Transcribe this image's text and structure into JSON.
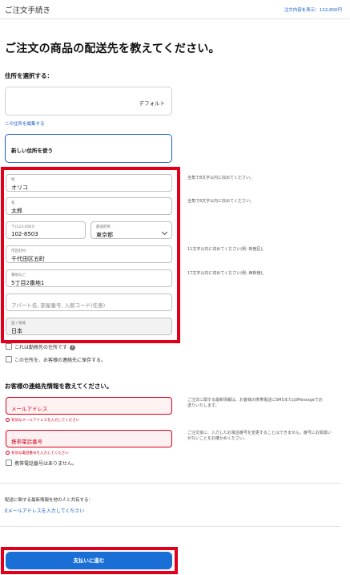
{
  "header": {
    "title": "ご注文手続き",
    "order_amount": "注文内容を表示：122,800円"
  },
  "heading": "ご注文の商品の配送先を教えてください。",
  "address_select": {
    "title": "住所を選択する：",
    "default_label": "デフォルト",
    "edit_link": "この住所を編集する",
    "new_address": "新しい住所を使う"
  },
  "form": {
    "last_name": {
      "label": "姓",
      "value": "オリコ"
    },
    "first_name": {
      "label": "名",
      "value": "太郎"
    },
    "postal": {
      "label": "〒(123-4567)",
      "value": "102-8503"
    },
    "prefecture": {
      "label": "都道府県",
      "value": "東京都"
    },
    "city": {
      "label": "市区町村",
      "value": "千代田区五町"
    },
    "street": {
      "label": "番地など",
      "value": "5丁目2番地1"
    },
    "building": {
      "placeholder": "アパート名, 部屋番号, 入館コード(任意)"
    },
    "country": {
      "label": "国 / 地域",
      "value": "日本"
    }
  },
  "hints": {
    "last_name": "全角で8文字以内に収めてください。",
    "first_name": "全角で8文字以内に収めてください。",
    "city": "11文字以内に収めてください(例: 新宿区)。",
    "street": "17文字以内に収めてください(例: 西新宿)。"
  },
  "checkboxes": {
    "work_address": "これは勤務先の住所です",
    "save_address": "この住所を、お客様の連絡先に保存する。",
    "no_mobile": "携帯電話番号はありません。"
  },
  "contact": {
    "title": "お客様の連絡先情報を教えてください。",
    "email_placeholder": "メールアドレス",
    "email_error": "有効なメールアドレスを入力してください",
    "email_hint": "ご注文に関する最新情報は、お客様の携帯電話にSMSまたはiMessageでお送りいたします。",
    "phone_placeholder": "携帯電話番号",
    "phone_error": "有効な電話番号を入力してください",
    "phone_hint": "ご注文後に、入力したお電話番号を変更することはできません。番号にお間違いがないことをお確かめください。"
  },
  "share": {
    "text": "配送に関する最新情報を他の人と共有する：",
    "link": "Eメールアドレスを入力してください"
  },
  "pay_button": "支払いに進む",
  "colors": {
    "accent_blue": "#1a6fd6",
    "highlight_red": "#e0001b"
  }
}
